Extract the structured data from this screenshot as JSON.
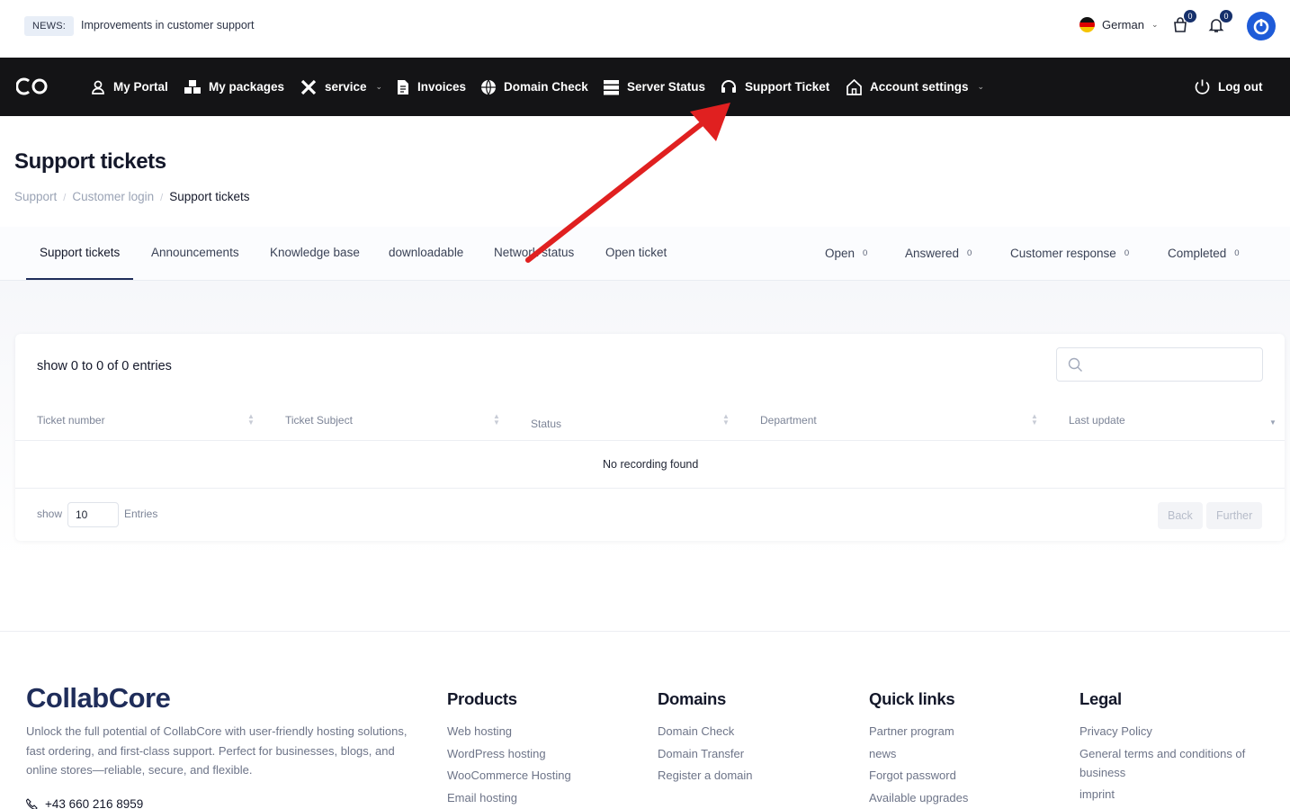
{
  "topbar": {
    "news_badge": "NEWS:",
    "news_text": "Improvements in customer support",
    "language": "German",
    "cart_count": "0",
    "notifications_count": "0"
  },
  "nav": {
    "items": [
      {
        "label": "My Portal",
        "icon": "user-icon"
      },
      {
        "label": "My packages",
        "icon": "boxes-icon"
      },
      {
        "label": "service",
        "icon": "tools-icon"
      },
      {
        "label": "Invoices",
        "icon": "document-icon"
      },
      {
        "label": "Domain Check",
        "icon": "globe-icon"
      },
      {
        "label": "Server Status",
        "icon": "server-icon"
      },
      {
        "label": "Support Ticket",
        "icon": "headset-icon"
      },
      {
        "label": "Account settings",
        "icon": "home-icon"
      }
    ],
    "logout": "Log out"
  },
  "page": {
    "title": "Support tickets",
    "breadcrumb": [
      "Support",
      "Customer login",
      "Support tickets"
    ]
  },
  "tabs": [
    "Support tickets",
    "Announcements",
    "Knowledge base",
    "downloadable",
    "Network status",
    "Open ticket"
  ],
  "stats": [
    {
      "label": "Open",
      "count": "0"
    },
    {
      "label": "Answered",
      "count": "0"
    },
    {
      "label": "Customer response",
      "count": "0"
    },
    {
      "label": "Completed",
      "count": "0"
    }
  ],
  "table": {
    "info": "show 0 to 0 of 0 entries",
    "search_placeholder": "",
    "columns": [
      "Ticket number",
      "Ticket Subject",
      "Status",
      "Department",
      "Last update"
    ],
    "empty": "No recording found",
    "show_label": "show",
    "per_page": "10",
    "entries_label": "Entries",
    "back": "Back",
    "further": "Further"
  },
  "footer": {
    "brand": "CollabCore",
    "description": "Unlock the full potential of CollabCore with user-friendly hosting solutions, fast ordering, and first-class support. Perfect for businesses, blogs, and online stores—reliable, secure, and flexible.",
    "phone": "+43 660 216 8959",
    "columns": [
      {
        "title": "Products",
        "links": [
          "Web hosting",
          "WordPress hosting",
          "WooCommerce Hosting",
          "Email hosting"
        ]
      },
      {
        "title": "Domains",
        "links": [
          "Domain Check",
          "Domain Transfer",
          "Register a domain"
        ]
      },
      {
        "title": "Quick links",
        "links": [
          "Partner program",
          "news",
          "Forgot password",
          "Available upgrades"
        ]
      },
      {
        "title": "Legal",
        "links": [
          "Privacy Policy",
          "General terms and conditions of business",
          "imprint"
        ]
      }
    ]
  },
  "colors": {
    "nav_bg": "#141416",
    "brand": "#1f2d5a",
    "accent": "#1e5bd8",
    "arrow": "#e02020"
  }
}
